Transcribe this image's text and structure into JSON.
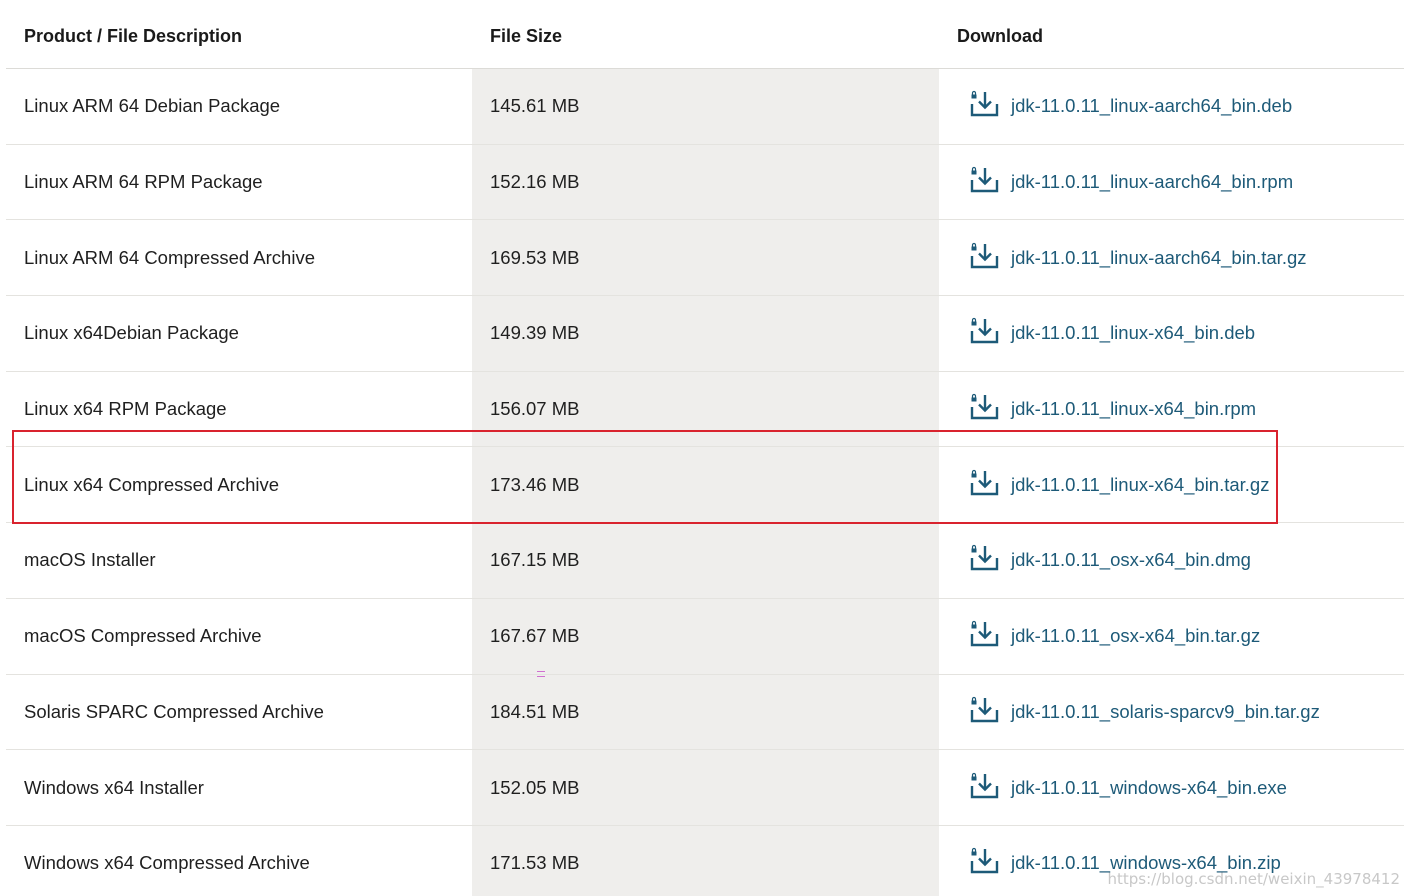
{
  "table": {
    "headers": {
      "product": "Product / File Description",
      "size": "File Size",
      "download": "Download"
    },
    "rows": [
      {
        "product": "Linux ARM 64 Debian Package",
        "size": "145.61 MB",
        "file": "jdk-11.0.11_linux-aarch64_bin.deb"
      },
      {
        "product": "Linux ARM 64 RPM Package",
        "size": "152.16 MB",
        "file": "jdk-11.0.11_linux-aarch64_bin.rpm"
      },
      {
        "product": "Linux ARM 64 Compressed Archive",
        "size": "169.53 MB",
        "file": "jdk-11.0.11_linux-aarch64_bin.tar.gz"
      },
      {
        "product": "Linux x64Debian Package",
        "size": "149.39 MB",
        "file": "jdk-11.0.11_linux-x64_bin.deb"
      },
      {
        "product": "Linux x64 RPM Package",
        "size": "156.07 MB",
        "file": "jdk-11.0.11_linux-x64_bin.rpm"
      },
      {
        "product": "Linux x64 Compressed Archive",
        "size": "173.46 MB",
        "file": "jdk-11.0.11_linux-x64_bin.tar.gz"
      },
      {
        "product": "macOS Installer",
        "size": "167.15 MB",
        "file": "jdk-11.0.11_osx-x64_bin.dmg"
      },
      {
        "product": "macOS Compressed Archive",
        "size": "167.67 MB",
        "file": "jdk-11.0.11_osx-x64_bin.tar.gz"
      },
      {
        "product": "Solaris SPARC Compressed Archive",
        "size": "184.51 MB",
        "file": "jdk-11.0.11_solaris-sparcv9_bin.tar.gz"
      },
      {
        "product": "Windows x64 Installer",
        "size": "152.05 MB",
        "file": "jdk-11.0.11_windows-x64_bin.exe"
      },
      {
        "product": "Windows x64 Compressed Archive",
        "size": "171.53 MB",
        "file": "jdk-11.0.11_windows-x64_bin.zip"
      }
    ]
  },
  "highlighted_row": 5,
  "icons": {
    "download": "download-lock-icon"
  },
  "colors": {
    "link": "#1d5a78",
    "size_column_bg": "#efeeec",
    "highlight_border": "#d9232e"
  },
  "watermark": "https://blog.csdn.net/weixin_43978412"
}
